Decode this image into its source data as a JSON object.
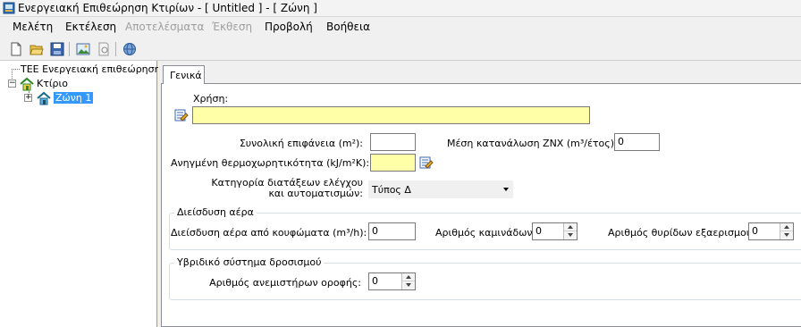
{
  "window": {
    "title": "Ενεργειακή Επιθεώρηση Κτιρίων - [ Untitled ] - [ Ζώνη ]"
  },
  "menu": {
    "items": [
      {
        "label": "Μελέτη",
        "enabled": true
      },
      {
        "label": "Εκτέλεση",
        "enabled": true
      },
      {
        "label": "Αποτελέσματα",
        "enabled": false
      },
      {
        "label": "Έκθεση",
        "enabled": false
      },
      {
        "label": "Προβολή",
        "enabled": true
      },
      {
        "label": "Βοήθεια",
        "enabled": true
      }
    ]
  },
  "toolbar": {
    "icons": [
      "new-file-icon",
      "open-folder-icon",
      "save-icon",
      "image-icon",
      "print-preview-icon",
      "web-icon"
    ]
  },
  "tree": {
    "root_label": "ΤΕΕ Ενεργειακή επιθεώρηση",
    "building_label": "Κτίριο",
    "zone_label": "Ζώνη 1",
    "expander_plus": "+",
    "expander_minus": "−"
  },
  "tabs": {
    "general_label": "Γενικά"
  },
  "form": {
    "usage_label": "Χρήση:",
    "usage_value": "",
    "total_area_label": "Συνολική επιφάνεια (m²):",
    "total_area_value": "",
    "dhw_consumption_label": "Μέση κατανάλωση ΖΝΧ (m³/έτος):",
    "dhw_consumption_value": "0",
    "heat_capacity_label": "Ανηγμένη θερμοχωρητικότητα (kJ/m²K):",
    "heat_capacity_value": "",
    "control_category_label_line1": "Κατηγορία διατάξεων ελέγχου",
    "control_category_label_line2": "και αυτοματισμών:",
    "control_category_value": "Τύπος Δ"
  },
  "air_infiltration": {
    "group_title": "Διείσδυση αέρα",
    "frames_label": "Διείσδυση αέρα από κουφώματα (m³/h):",
    "frames_value": "0",
    "chimneys_label": "Αριθμός καμινάδων:",
    "chimneys_value": "0",
    "vent_openings_label": "Αριθμός θυρίδων εξαερισμού:",
    "vent_openings_value": "0"
  },
  "hybrid_cooling": {
    "group_title": "Υβριδικό σύστημα δροσισμού",
    "ceiling_fans_label": "Αριθμός ανεμιστήρων οροφής:",
    "ceiling_fans_value": "0"
  },
  "colors": {
    "highlight_yellow": "#ffffa8",
    "selection_blue": "#3399ff",
    "disabled_text": "#a0a0a0"
  }
}
